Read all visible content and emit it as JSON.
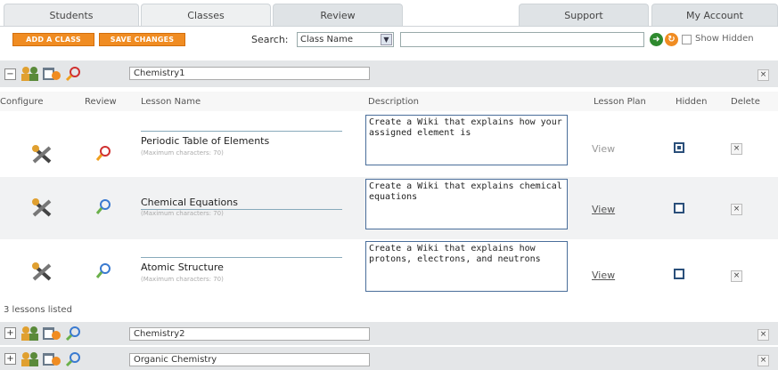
{
  "tabs": [
    "Students",
    "Classes",
    "Review",
    "Support",
    "My Account"
  ],
  "toolbar": {
    "add_class": "ADD A CLASS",
    "save_changes": "SAVE CHANGES",
    "search_label": "Search:",
    "search_field": "Class Name",
    "search_value": "",
    "show_hidden": "Show Hidden"
  },
  "columns": {
    "configure": "Configure",
    "review": "Review",
    "lesson_name": "Lesson Name",
    "description": "Description",
    "lesson_plan": "Lesson Plan",
    "hidden": "Hidden",
    "delete": "Delete"
  },
  "groups": [
    {
      "name": "Chemistry1",
      "expanded": true
    },
    {
      "name": "Chemistry2",
      "expanded": false
    },
    {
      "name": "Organic Chemistry",
      "expanded": false
    }
  ],
  "lessons": [
    {
      "name": "Periodic Table of Elements",
      "sub": "(Maximum characters: 70)",
      "description": "Create a Wiki that explains how your assigned element is",
      "plan": "View",
      "hidden": true
    },
    {
      "name": "Chemical Equations",
      "sub": "(Maximum characters: 70)",
      "description": "Create a Wiki that explains chemical equations",
      "plan": "View",
      "hidden": false
    },
    {
      "name": "Atomic Structure",
      "sub": "(Maximum characters: 70)",
      "description": "Create a Wiki that explains how protons, electrons, and neutrons",
      "plan": "View",
      "hidden": false
    }
  ],
  "footer": "3 lessons listed",
  "colors": {
    "accent": "#f08c22",
    "header_bg": "#e4e6e8",
    "row_alt": "#f1f2f3",
    "border_blue": "#4a6e9a"
  },
  "icons": [
    "collapse-icon",
    "people-icon",
    "calendar-icon",
    "review-icon",
    "configure-icon",
    "go-icon",
    "refresh-icon",
    "delete-icon"
  ]
}
